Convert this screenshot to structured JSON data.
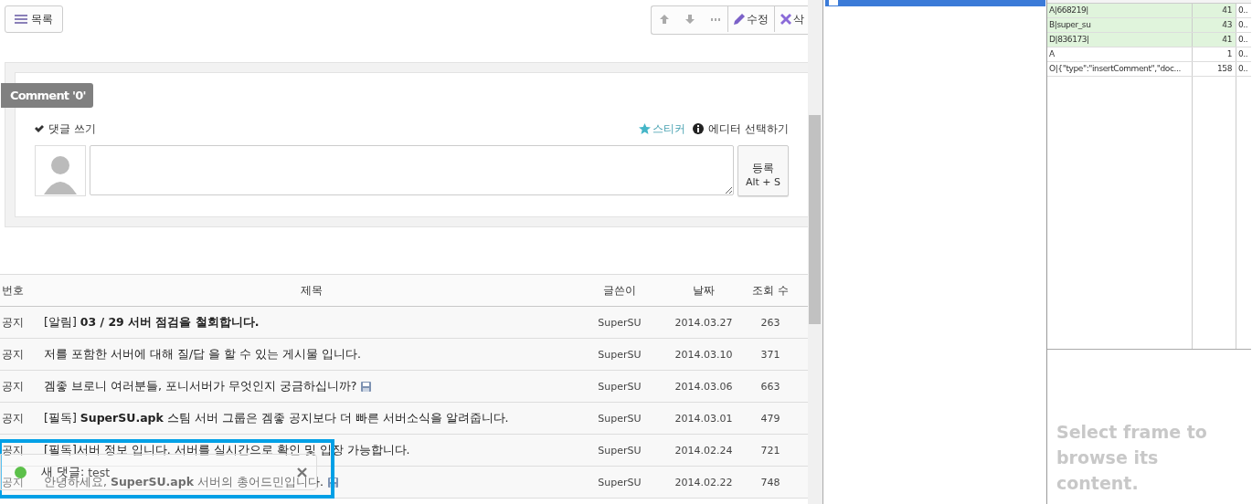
{
  "toolbar": {
    "list_button": "목록",
    "actions": [
      {
        "kind": "up"
      },
      {
        "kind": "down"
      },
      {
        "kind": "more"
      },
      {
        "kind": "edit",
        "label": "수정"
      },
      {
        "kind": "delete",
        "label": "삭"
      }
    ]
  },
  "comments": {
    "title": "Comment '0'",
    "write_label": "댓글 쓰기",
    "sticker": "스티커",
    "editor": "에디터 선택하기",
    "submit": "등록",
    "shortcut": "Alt + S"
  },
  "table": {
    "columns": [
      "번호",
      "제목",
      "글쓴이",
      "날짜",
      "조회 수"
    ],
    "rows": [
      {
        "number": "공지",
        "title": "[알림] **03 / 29 서버 점검을 철회합니다.**",
        "attachment": false,
        "author": "SuperSU",
        "date": "2014.03.27",
        "views": "263"
      },
      {
        "number": "공지",
        "title": "저를 포함한 서버에 대해 질/답 을 할 수 있는 게시물 입니다.",
        "attachment": false,
        "author": "SuperSU",
        "date": "2014.03.10",
        "views": "371"
      },
      {
        "number": "공지",
        "title": "겜좋 브로니 여러분들, 포니서버가 무엇인지 궁금하십니까?",
        "attachment": true,
        "author": "SuperSU",
        "date": "2014.03.06",
        "views": "663"
      },
      {
        "number": "공지",
        "title": "[필독] **SuperSU.apk** 스팀 서버 그룹은 겜좋 공지보다 더 빠른 서버소식을 알려줍니다.",
        "attachment": false,
        "author": "SuperSU",
        "date": "2014.03.01",
        "views": "479"
      },
      {
        "number": "공지",
        "title": "[필독]서버 정보 입니다. 서버를 실시간으로 확인 및 입장 가능합니다.",
        "attachment": false,
        "author": "SuperSU",
        "date": "2014.02.24",
        "views": "721"
      },
      {
        "number": "공지",
        "title": "안녕하세요, **SuperSU.apk** 서버의 총어드민입니다.",
        "attachment": true,
        "author": "SuperSU",
        "date": "2014.02.22",
        "views": "748"
      }
    ]
  },
  "toast": {
    "label": "새 댓글:",
    "message": "test"
  },
  "network_list": {
    "rows": [
      {
        "selected": true
      }
    ]
  },
  "frames": {
    "rows": [
      {
        "data": "A|668219|",
        "length": "41",
        "time": "0..",
        "highlighted": true
      },
      {
        "data": "B|super_su",
        "length": "43",
        "time": "0..",
        "highlighted": true
      },
      {
        "data": "D|836173|",
        "length": "41",
        "time": "0..",
        "highlighted": true
      },
      {
        "data": "A",
        "length": "1",
        "time": "0..",
        "highlighted": false
      },
      {
        "data": "O|{\"type\":\"insertComment\",\"doc...",
        "length": "158",
        "time": "0..",
        "highlighted": false
      }
    ]
  },
  "preview": {
    "message": "Select frame to browse its content."
  }
}
